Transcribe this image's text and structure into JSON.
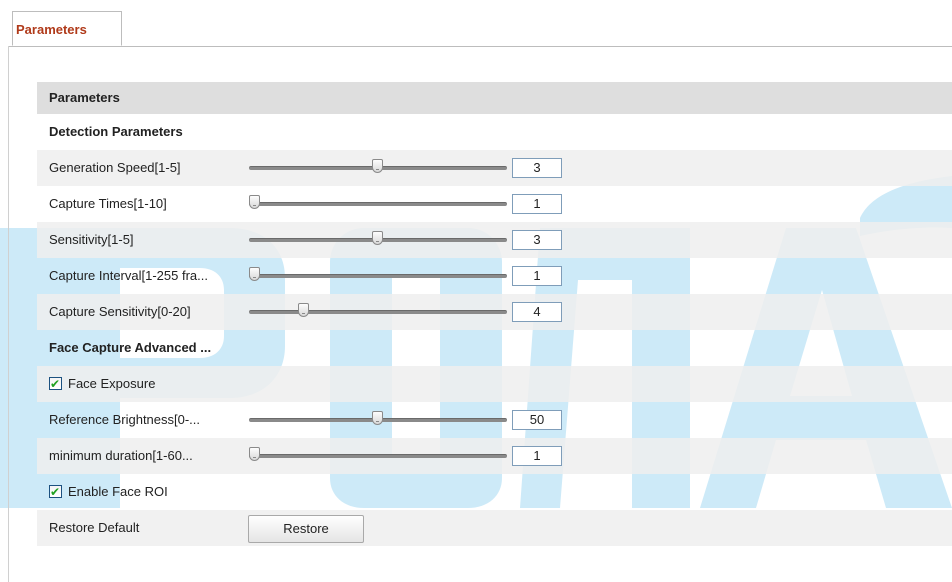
{
  "tab": {
    "label": "Parameters"
  },
  "panel": {
    "header": "Parameters",
    "detection_title": "Detection Parameters",
    "detection_rows": [
      {
        "label": "Generation Speed[1-5]",
        "value": "3",
        "fraction": 0.5
      },
      {
        "label": "Capture Times[1-10]",
        "value": "1",
        "fraction": 0.0
      },
      {
        "label": "Sensitivity[1-5]",
        "value": "3",
        "fraction": 0.5
      },
      {
        "label": "Capture Interval[1-255 fra...",
        "value": "1",
        "fraction": 0.0
      },
      {
        "label": "Capture Sensitivity[0-20]",
        "value": "4",
        "fraction": 0.2
      }
    ],
    "advanced_title": "Face Capture Advanced ...",
    "face_exposure": {
      "label": "Face Exposure",
      "checked": true
    },
    "advanced_rows": [
      {
        "label": "Reference Brightness[0-...",
        "value": "50",
        "fraction": 0.5
      },
      {
        "label": "minimum duration[1-60...",
        "value": "1",
        "fraction": 0.0
      }
    ],
    "enable_roi": {
      "label": "Enable Face ROI",
      "checked": true
    },
    "restore": {
      "label": "Restore Default",
      "button": "Restore"
    }
  },
  "colors": {
    "tab_text": "#b03a1a",
    "header_bg": "#dedede",
    "watermark": "#1a9fe0",
    "checkbox_tick": "#21a121"
  },
  "icons": {
    "checkbox_mark": "✔"
  }
}
